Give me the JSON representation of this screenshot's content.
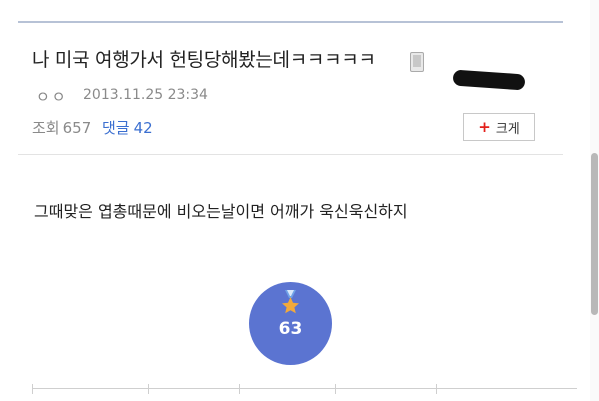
{
  "post": {
    "title": "나 미국 여행가서 헌팅당해봤는데ㅋㅋㅋㅋㅋ",
    "author_nick": "ㅇㅇ",
    "date": "2013.11.25 23:34",
    "views_label": "조회",
    "views_count": "657",
    "comments_label": "댓글",
    "comments_count": "42",
    "body": "그때맞은 엽총때문에 비오는날이면 어깨가 욱신욱신하지"
  },
  "toolbar": {
    "bigger_label": "크게"
  },
  "recommend": {
    "count": "63"
  },
  "colors": {
    "accent_blue": "#3b6fd0",
    "recommend_bg": "#5b74d1",
    "plus_red": "#e3201b",
    "star_gold": "#f2a93b"
  },
  "icons": [
    "mobile-icon",
    "plus-icon",
    "star-medal-icon"
  ]
}
